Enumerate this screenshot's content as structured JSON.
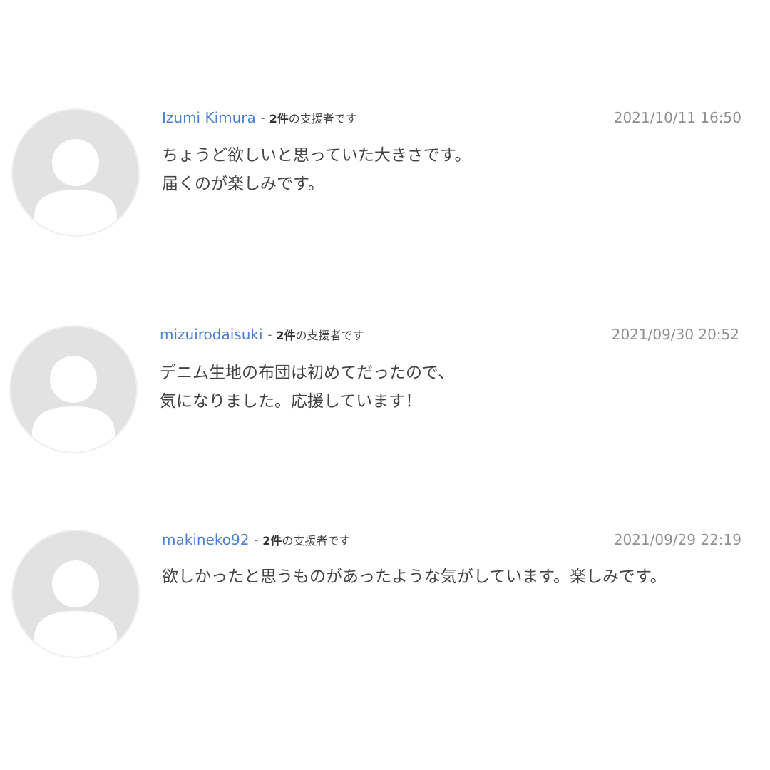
{
  "comments": [
    {
      "user": "Izumi Kimura",
      "separator": "-",
      "support_count": "2件",
      "support_text": "の支援者です",
      "timestamp": "2021/10/11 16:50",
      "lines": [
        "ちょうど欲しいと思っていた大きさです。",
        "届くのが楽しみです。"
      ],
      "avatar_icon": "default-user-avatar-icon"
    },
    {
      "user": "mizuirodaisuki",
      "separator": "-",
      "support_count": "2件",
      "support_text": "の支援者です",
      "timestamp": "2021/09/30 20:52",
      "lines": [
        "デニム生地の布団は初めてだったので、",
        "気になりました。応援しています！"
      ],
      "avatar_icon": "default-user-avatar-icon"
    },
    {
      "user": "makineko92",
      "separator": "-",
      "support_count": "2件",
      "support_text": "の支援者です",
      "timestamp": "2021/09/29 22:19",
      "lines": [
        "欲しかったと思うものがあったような気がしています。楽しみです。"
      ],
      "avatar_icon": "default-user-avatar-icon"
    }
  ],
  "colors": {
    "user_link": "#4a7fd2",
    "timestamp": "#8e8e8e",
    "body_text": "#444444",
    "avatar_bg": "#e2e2e2",
    "avatar_figure": "#ffffff"
  }
}
